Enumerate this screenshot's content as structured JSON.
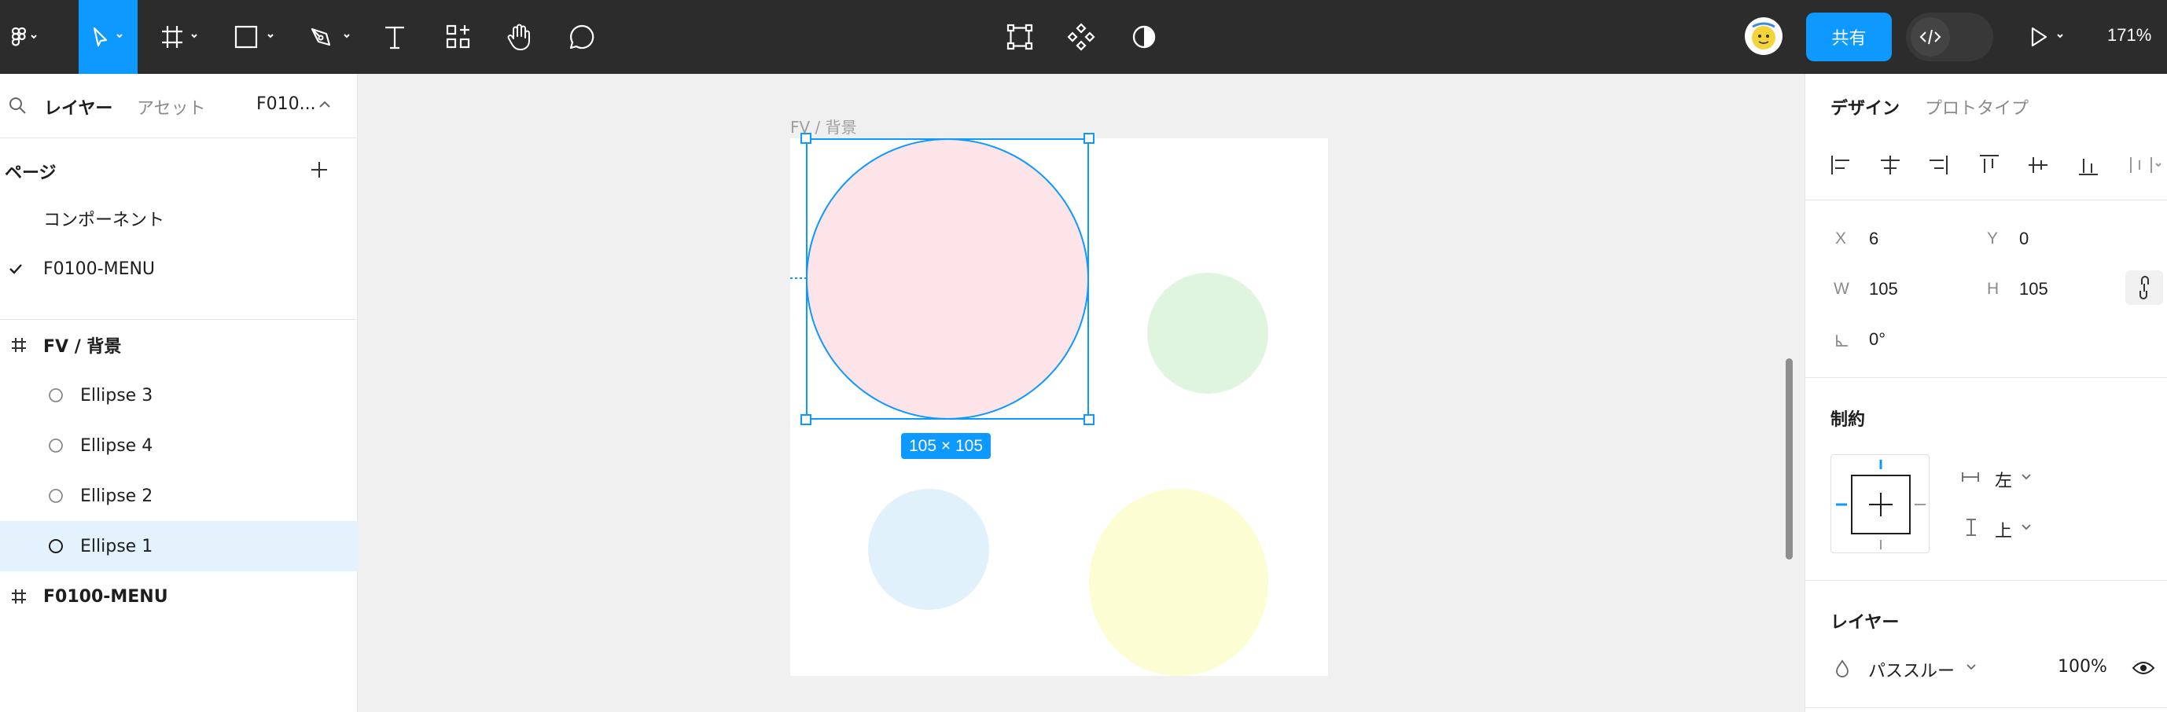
{
  "toolbar": {
    "share_label": "共有",
    "zoom": "171%"
  },
  "left_panel": {
    "tabs": {
      "layers": "レイヤー",
      "assets": "アセット",
      "page_selector": "F010..."
    },
    "pages_title": "ページ",
    "pages": [
      {
        "label": "コンポーネント",
        "checked": false
      },
      {
        "label": "F0100-MENU",
        "checked": true
      }
    ],
    "layers": [
      {
        "label": "FV / 背景",
        "kind": "frame",
        "indent": 0,
        "bold": true,
        "selected": false
      },
      {
        "label": "Ellipse 3",
        "kind": "ellipse",
        "indent": 1,
        "bold": false,
        "selected": false
      },
      {
        "label": "Ellipse 4",
        "kind": "ellipse",
        "indent": 1,
        "bold": false,
        "selected": false
      },
      {
        "label": "Ellipse 2",
        "kind": "ellipse",
        "indent": 1,
        "bold": false,
        "selected": false
      },
      {
        "label": "Ellipse 1",
        "kind": "ellipse",
        "indent": 1,
        "bold": false,
        "selected": true
      },
      {
        "label": "F0100-MENU",
        "kind": "frame",
        "indent": 0,
        "bold": true,
        "selected": false
      }
    ]
  },
  "canvas": {
    "frame_label": "FV / 背景",
    "selection_size": "105 × 105",
    "colors": {
      "pink": "#fce4e8",
      "green": "#e0f5df",
      "blue": "#e0f1fc",
      "yellow": "#fdfdd4",
      "selection": "#0d99ff"
    }
  },
  "right_panel": {
    "tabs": {
      "design": "デザイン",
      "prototype": "プロトタイプ"
    },
    "x_label": "X",
    "x_value": "6",
    "y_label": "Y",
    "y_value": "0",
    "w_label": "W",
    "w_value": "105",
    "h_label": "H",
    "h_value": "105",
    "rotation_value": "0°",
    "constraints_title": "制約",
    "horizontal_constraint": "左",
    "vertical_constraint": "上",
    "layer_title": "レイヤー",
    "blend_mode": "パススルー",
    "opacity": "100%"
  }
}
